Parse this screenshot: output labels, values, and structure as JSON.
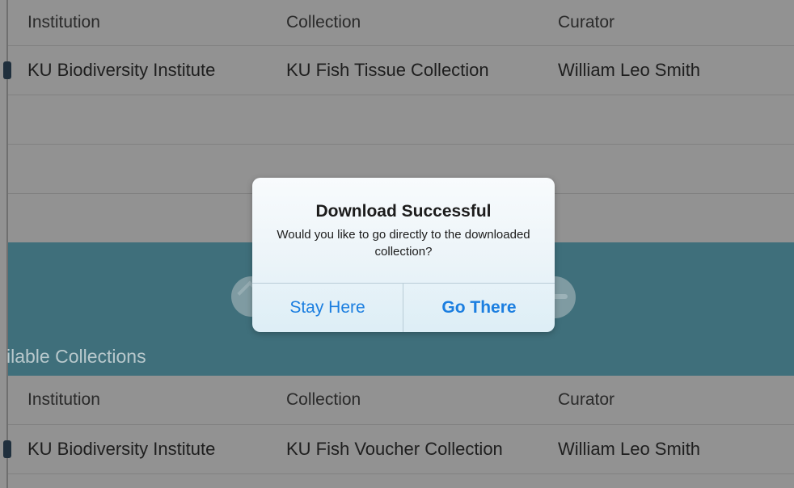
{
  "top_table": {
    "headers": {
      "institution": "Institution",
      "collection": "Collection",
      "curator": "Curator"
    },
    "row": {
      "institution": "KU Biodiversity Institute",
      "collection": "KU Fish Tissue Collection",
      "curator": "William Leo Smith"
    }
  },
  "available_section": {
    "title": "ilable Collections"
  },
  "bottom_table": {
    "headers": {
      "institution": "Institution",
      "collection": "Collection",
      "curator": "Curator"
    },
    "row": {
      "institution": "KU Biodiversity Institute",
      "collection": "KU Fish Voucher Collection",
      "curator": "William Leo Smith"
    }
  },
  "dialog": {
    "title": "Download Successful",
    "message": "Would you like to go directly to the downloaded collection?",
    "stay_label": "Stay Here",
    "go_label": "Go There"
  },
  "colors": {
    "accent": "#1b7ee0",
    "band": "#3f6f7b",
    "overlay": "#929292"
  }
}
